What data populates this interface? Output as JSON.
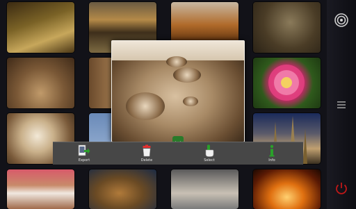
{
  "toolbar": {
    "export_label": "Export",
    "delete_label": "Delete",
    "select_label": "Select",
    "info_label": "Info"
  },
  "icons": {
    "export": "export-icon",
    "delete": "trash-icon",
    "select": "hand-pointer-icon",
    "info": "info-icon",
    "collapse": "chevron-down-icon",
    "target": "target-icon",
    "menu": "menu-icon",
    "power": "power-icon"
  },
  "colors": {
    "toolbar_bg": "#474747",
    "accent_green": "#2a8a2a",
    "power_red": "#c01818"
  }
}
